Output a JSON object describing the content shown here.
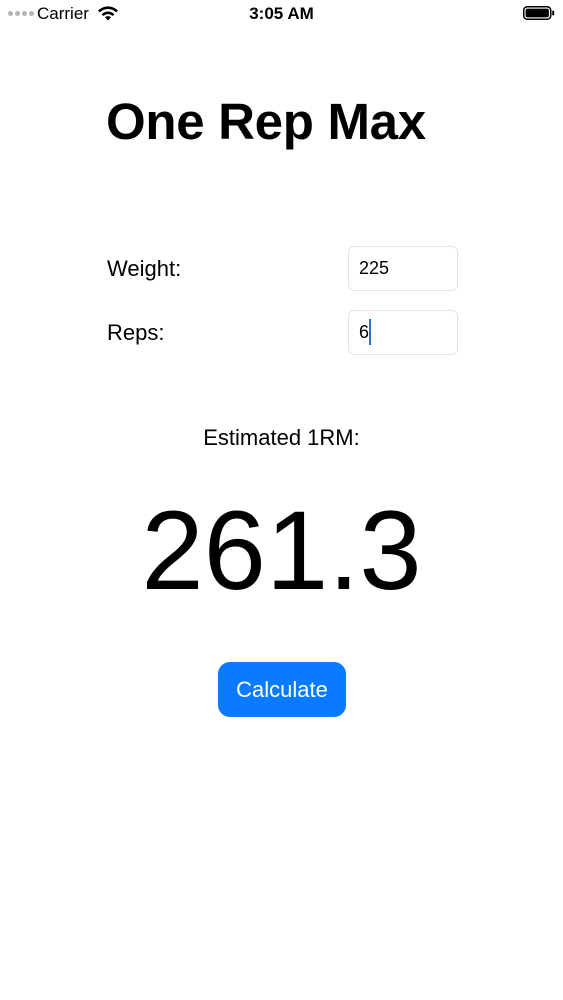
{
  "status_bar": {
    "carrier": "Carrier",
    "time": "3:05 AM",
    "icons": [
      "signal-dots-icon",
      "wifi-icon",
      "battery-icon"
    ]
  },
  "title": "One Rep Max",
  "form": {
    "weight_label": "Weight:",
    "weight_value": "225",
    "reps_label": "Reps:",
    "reps_value": "6"
  },
  "result": {
    "label": "Estimated 1RM:",
    "value": "261.3"
  },
  "button": {
    "label": "Calculate",
    "color": "#0a7aff"
  },
  "colors": {
    "caret": "#2f6bd8",
    "background": "#ffffff"
  }
}
